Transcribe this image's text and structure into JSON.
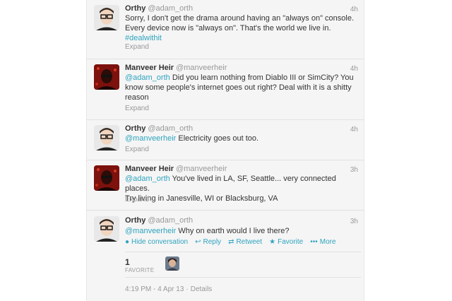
{
  "tweets": [
    {
      "fullname": "Orthy",
      "username": "@adam_orth",
      "time": "4h",
      "avatar": "orthy-avatar",
      "text_lines": [
        "Sorry, I don't get the drama around having an \"always on\" console.",
        "Every device now is \"always on\". That's the world we live in."
      ],
      "hashtag": "#dealwithit",
      "expand": "Expand"
    },
    {
      "fullname": "Manveer Heir",
      "username": "@manveerheir",
      "time": "4h",
      "avatar": "manveer-avatar",
      "mention": "@adam_orth",
      "text_first": " Did you learn nothing from Diablo III or SimCity? You",
      "text_rest": [
        "know some people's internet goes out right? Deal with it is a shitty",
        "reason"
      ],
      "expand": "Expand"
    },
    {
      "fullname": "Orthy",
      "username": "@adam_orth",
      "time": "4h",
      "avatar": "orthy-avatar",
      "mention": "@manveerheir",
      "text_first": " Electricity goes out too.",
      "expand": "Expand"
    },
    {
      "fullname": "Manveer Heir",
      "username": "@manveerheir",
      "time": "3h",
      "avatar": "manveer-avatar",
      "mention": "@adam_orth",
      "text_first": " You've lived in LA, SF, Seattle... very connected places.",
      "text_rest": [
        "Try living in Janesville, WI or Blacksburg, VA"
      ],
      "expand": "Expand"
    },
    {
      "fullname": "Orthy",
      "username": "@adam_orth",
      "time": "3h",
      "avatar": "orthy-avatar",
      "mention": "@manveerheir",
      "text_first": " Why on earth would I live there?",
      "actions": {
        "hide": "Hide conversation",
        "reply": "Reply",
        "retweet": "Retweet",
        "favorite": "Favorite",
        "more": "More"
      },
      "favorites_count": "1",
      "favorites_label": "FAVORITE",
      "timestamp": "4:19 PM - 4 Apr 13",
      "details": "Details"
    }
  ],
  "colors": {
    "link": "#2fa4bf",
    "muted": "#999999",
    "text": "#333333",
    "background": "#f5f5f5"
  }
}
